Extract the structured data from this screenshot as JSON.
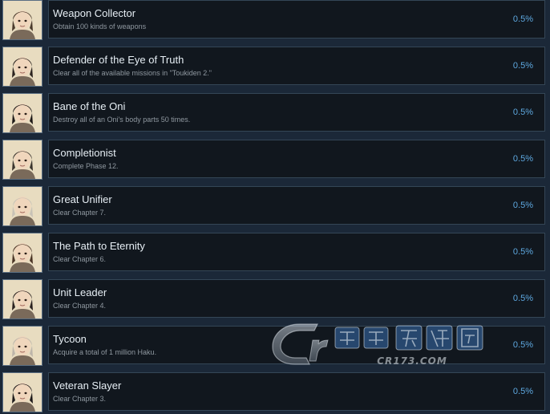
{
  "achievements": [
    {
      "title": "Weapon Collector",
      "description": "Obtain 100 kinds of weapons",
      "percent": "0.5%",
      "portrait_icon": "long-hair-woman-portrait",
      "accent": "#4a3a2c"
    },
    {
      "title": "Defender of the Eye of Truth",
      "description": "Clear all of the available missions in \"Toukiden 2.\"",
      "percent": "0.5%",
      "portrait_icon": "dark-hair-woman-portrait",
      "accent": "#2c2420"
    },
    {
      "title": "Bane of the Oni",
      "description": "Destroy all of an Oni's body parts 50 times.",
      "percent": "0.5%",
      "portrait_icon": "short-hair-girl-portrait",
      "accent": "#1f1a18"
    },
    {
      "title": "Completionist",
      "description": "Complete Phase 12.",
      "percent": "0.5%",
      "portrait_icon": "bearded-man-portrait",
      "accent": "#3a352e"
    },
    {
      "title": "Great Unifier",
      "description": "Clear Chapter 7.",
      "percent": "0.5%",
      "portrait_icon": "pale-hair-youth-portrait",
      "accent": "#c8c2b6"
    },
    {
      "title": "The Path to Eternity",
      "description": "Clear Chapter 6.",
      "percent": "0.5%",
      "portrait_icon": "brown-hair-woman-portrait",
      "accent": "#4b3526"
    },
    {
      "title": "Unit Leader",
      "description": "Clear Chapter 4.",
      "percent": "0.5%",
      "portrait_icon": "headband-warrior-portrait",
      "accent": "#2a2220"
    },
    {
      "title": "Tycoon",
      "description": "Acquire a total of 1 million Haku.",
      "percent": "0.5%",
      "portrait_icon": "laughing-old-man-portrait",
      "accent": "#bdb5aa"
    },
    {
      "title": "Veteran Slayer",
      "description": "Clear Chapter 3.",
      "percent": "0.5%",
      "portrait_icon": "young-man-portrait",
      "accent": "#1e1a1a"
    }
  ],
  "watermark": {
    "brand": "Cr",
    "domain": "CR173.COM"
  },
  "colors": {
    "background": "#1b2838",
    "row_fill": "#11171e",
    "row_border": "#344656",
    "title_text": "#e6eef4",
    "description_text": "#8f98a0",
    "percent_text": "#5ea8e0"
  }
}
